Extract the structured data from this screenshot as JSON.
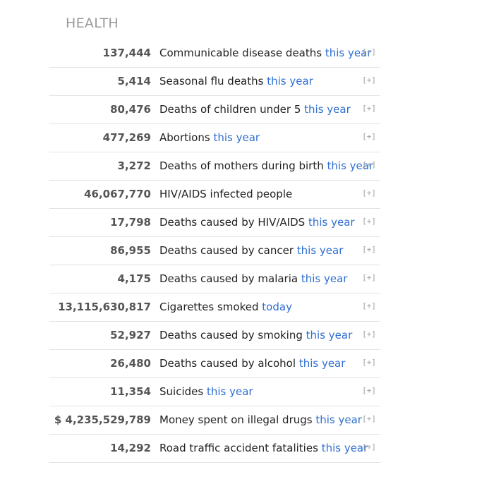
{
  "section": {
    "title": "HEALTH"
  },
  "expand_label": "[+]",
  "rows": [
    {
      "value": "137,444",
      "label": "Communicable disease deaths",
      "period": "this year"
    },
    {
      "value": "5,414",
      "label": "Seasonal flu deaths",
      "period": "this year"
    },
    {
      "value": "80,476",
      "label": "Deaths of children under 5",
      "period": "this year"
    },
    {
      "value": "477,269",
      "label": "Abortions",
      "period": "this year"
    },
    {
      "value": "3,272",
      "label": "Deaths of mothers during birth",
      "period": "this year"
    },
    {
      "value": "46,067,770",
      "label": "HIV/AIDS infected people",
      "period": ""
    },
    {
      "value": "17,798",
      "label": "Deaths caused by HIV/AIDS",
      "period": "this year"
    },
    {
      "value": "86,955",
      "label": "Deaths caused by cancer",
      "period": "this year"
    },
    {
      "value": "4,175",
      "label": "Deaths caused by malaria",
      "period": "this year"
    },
    {
      "value": "13,115,630,817",
      "label": "Cigarettes smoked",
      "period": "today"
    },
    {
      "value": "52,927",
      "label": "Deaths caused by smoking",
      "period": "this year"
    },
    {
      "value": "26,480",
      "label": "Deaths caused by alcohol",
      "period": "this year"
    },
    {
      "value": "11,354",
      "label": "Suicides",
      "period": "this year"
    },
    {
      "value": "$ 4,235,529,789",
      "label": "Money spent on illegal drugs",
      "period": "this year"
    },
    {
      "value": "14,292",
      "label": "Road traffic accident fatalities",
      "period": "this year"
    }
  ]
}
